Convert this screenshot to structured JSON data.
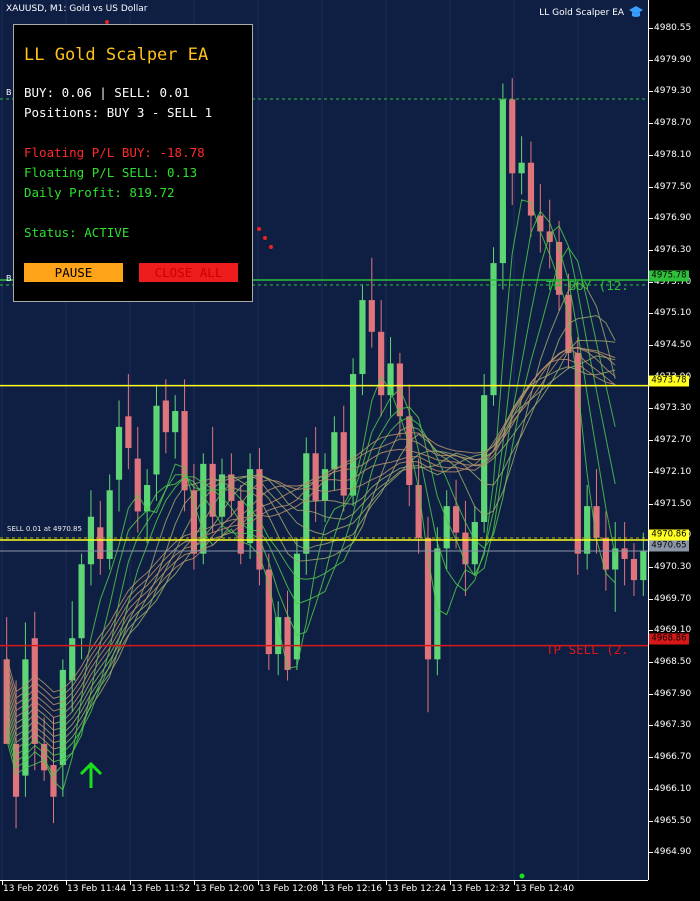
{
  "header": {
    "symbol_title": "XAUUSD, M1:  Gold vs US Dollar",
    "ea_name": "LL Gold Scalper EA",
    "ea_icon": "graduation-cap-icon"
  },
  "panel": {
    "title": "LL Gold Scalper EA",
    "lots_line": "BUY: 0.06 | SELL: 0.01",
    "positions_line": "Positions: BUY 3 - SELL 1",
    "floating_buy": "Floating P/L BUY: -18.78",
    "floating_sell": "Floating P/L SELL: 0.13",
    "daily_profit": "Daily Profit: 819.72",
    "status": "Status: ACTIVE",
    "pause_label": "PAUSE",
    "close_all_label": "CLOSE ALL"
  },
  "lines": {
    "tp_buy_label": "TP BUY (12.",
    "tp_sell_label": "TP SELL (2.",
    "sell_lot_label": "SELL 0.01 at 4970.85",
    "b_marker": "B"
  },
  "price_tags": {
    "tp_buy": "4975.78",
    "yellow_mid": "4973.78",
    "entry": "4970.86",
    "current": "4970.65",
    "tp_sell": "4968.86"
  },
  "colors": {
    "background": "#0f1f44",
    "bull": "#5fd675",
    "bear": "#e0747d",
    "tp_buy": "#2fbf3a",
    "tp_sell": "#d81818",
    "yellow": "#ffff20",
    "panel_title": "#ffc21a"
  },
  "price_axis": [
    "4980.55",
    "4979.90",
    "4979.30",
    "4978.70",
    "4978.10",
    "4977.50",
    "4976.90",
    "4976.30",
    "4975.70",
    "4975.10",
    "4974.50",
    "4973.90",
    "4973.30",
    "4972.70",
    "4972.10",
    "4971.50",
    "4970.90",
    "4970.30",
    "4969.70",
    "4969.10",
    "4968.50",
    "4967.90",
    "4967.30",
    "4966.70",
    "4966.10",
    "4965.50",
    "4964.90"
  ],
  "time_axis": [
    "13 Feb 2026",
    "13 Feb 11:44",
    "13 Feb 11:52",
    "13 Feb 12:00",
    "13 Feb 12:08",
    "13 Feb 12:16",
    "13 Feb 12:24",
    "13 Feb 12:32",
    "13 Feb 12:40"
  ],
  "chart_data": {
    "type": "candlestick",
    "symbol": "XAUUSD",
    "timeframe": "M1",
    "ylim": [
      4964.6,
      4981.0
    ],
    "horizontal_lines": [
      {
        "name": "TP BUY",
        "price": 4975.78
      },
      {
        "name": "yellow",
        "price": 4973.78
      },
      {
        "name": "entry",
        "price": 4970.86
      },
      {
        "name": "bid",
        "price": 4970.65
      },
      {
        "name": "TP SELL",
        "price": 4968.86
      }
    ],
    "candles": [
      [
        4968.6,
        4969.4,
        4967.6,
        4967.0
      ],
      [
        4967.0,
        4968.2,
        4965.4,
        4966.0
      ],
      [
        4966.4,
        4969.3,
        4966.0,
        4968.6
      ],
      [
        4969.0,
        4969.5,
        4966.5,
        4967.0
      ],
      [
        4967.0,
        4967.5,
        4966.3,
        4966.5
      ],
      [
        4966.6,
        4967.5,
        4965.5,
        4966.0
      ],
      [
        4966.6,
        4968.6,
        4966.0,
        4968.4
      ],
      [
        4968.2,
        4969.7,
        4967.6,
        4969.0
      ],
      [
        4969.0,
        4970.6,
        4968.6,
        4970.4
      ],
      [
        4970.4,
        4971.8,
        4970.0,
        4971.3
      ],
      [
        4971.1,
        4971.6,
        4970.2,
        4970.5
      ],
      [
        4970.5,
        4972.1,
        4970.3,
        4971.8
      ],
      [
        4972.0,
        4973.5,
        4971.4,
        4973.0
      ],
      [
        4973.2,
        4974.0,
        4972.2,
        4972.6
      ],
      [
        4972.4,
        4973.0,
        4971.0,
        4971.4
      ],
      [
        4971.4,
        4972.2,
        4970.8,
        4971.9
      ],
      [
        4972.1,
        4973.8,
        4971.6,
        4973.4
      ],
      [
        4973.5,
        4973.9,
        4972.5,
        4972.9
      ],
      [
        4972.9,
        4973.6,
        4972.4,
        4973.3
      ],
      [
        4973.3,
        4973.9,
        4971.4,
        4971.8
      ],
      [
        4971.8,
        4972.3,
        4970.3,
        4970.6
      ],
      [
        4970.6,
        4972.5,
        4970.4,
        4972.3
      ],
      [
        4972.3,
        4973.0,
        4971.0,
        4971.3
      ],
      [
        4971.3,
        4972.4,
        4970.9,
        4972.1
      ],
      [
        4972.1,
        4972.5,
        4971.3,
        4971.6
      ],
      [
        4971.6,
        4971.9,
        4970.4,
        4970.6
      ],
      [
        4970.8,
        4972.5,
        4970.5,
        4972.2
      ],
      [
        4972.2,
        4972.6,
        4970.0,
        4970.3
      ],
      [
        4970.3,
        4970.6,
        4968.4,
        4968.7
      ],
      [
        4968.7,
        4969.7,
        4968.3,
        4969.4
      ],
      [
        4969.4,
        4969.9,
        4968.2,
        4968.4
      ],
      [
        4968.6,
        4970.9,
        4968.4,
        4970.6
      ],
      [
        4970.6,
        4972.8,
        4970.2,
        4972.5
      ],
      [
        4972.5,
        4973.0,
        4971.2,
        4971.6
      ],
      [
        4971.6,
        4972.5,
        4971.2,
        4972.2
      ],
      [
        4972.2,
        4973.2,
        4971.8,
        4972.9
      ],
      [
        4972.9,
        4973.4,
        4971.4,
        4971.7
      ],
      [
        4971.7,
        4974.3,
        4971.5,
        4974.0
      ],
      [
        4974.0,
        4975.7,
        4973.6,
        4975.4
      ],
      [
        4975.4,
        4976.2,
        4974.5,
        4974.8
      ],
      [
        4974.8,
        4975.4,
        4973.2,
        4973.6
      ],
      [
        4973.6,
        4974.7,
        4973.2,
        4974.2
      ],
      [
        4974.2,
        4974.4,
        4972.8,
        4973.2
      ],
      [
        4973.2,
        4973.8,
        4971.5,
        4971.9
      ],
      [
        4971.9,
        4972.4,
        4970.6,
        4970.9
      ],
      [
        4970.9,
        4971.3,
        4967.6,
        4968.6
      ],
      [
        4968.6,
        4971.1,
        4968.3,
        4970.7
      ],
      [
        4970.7,
        4971.8,
        4970.3,
        4971.5
      ],
      [
        4971.5,
        4972.0,
        4970.7,
        4971.0
      ],
      [
        4971.0,
        4971.6,
        4969.8,
        4970.4
      ],
      [
        4970.4,
        4971.5,
        4970.2,
        4971.2
      ],
      [
        4971.2,
        4974.0,
        4971.0,
        4973.6
      ],
      [
        4973.6,
        4976.4,
        4973.4,
        4976.1
      ],
      [
        4976.1,
        4979.5,
        4975.6,
        4979.2
      ],
      [
        4979.2,
        4979.6,
        4977.2,
        4977.8
      ],
      [
        4977.8,
        4978.5,
        4977.4,
        4978.0
      ],
      [
        4978.0,
        4978.4,
        4976.6,
        4977.0
      ],
      [
        4977.0,
        4977.6,
        4976.3,
        4976.7
      ],
      [
        4976.7,
        4977.3,
        4976.0,
        4976.5
      ],
      [
        4976.5,
        4976.9,
        4975.2,
        4975.5
      ],
      [
        4975.5,
        4975.9,
        4974.1,
        4974.4
      ],
      [
        4974.4,
        4974.7,
        4970.2,
        4970.6
      ],
      [
        4970.6,
        4971.9,
        4970.3,
        4971.5
      ],
      [
        4971.5,
        4972.2,
        4970.6,
        4970.9
      ],
      [
        4970.9,
        4971.4,
        4969.9,
        4970.3
      ],
      [
        4970.3,
        4971.2,
        4969.5,
        4970.7
      ],
      [
        4970.7,
        4971.2,
        4970.0,
        4970.5
      ],
      [
        4970.5,
        4970.8,
        4969.8,
        4970.1
      ],
      [
        4970.1,
        4971.0,
        4969.8,
        4970.65
      ]
    ]
  }
}
